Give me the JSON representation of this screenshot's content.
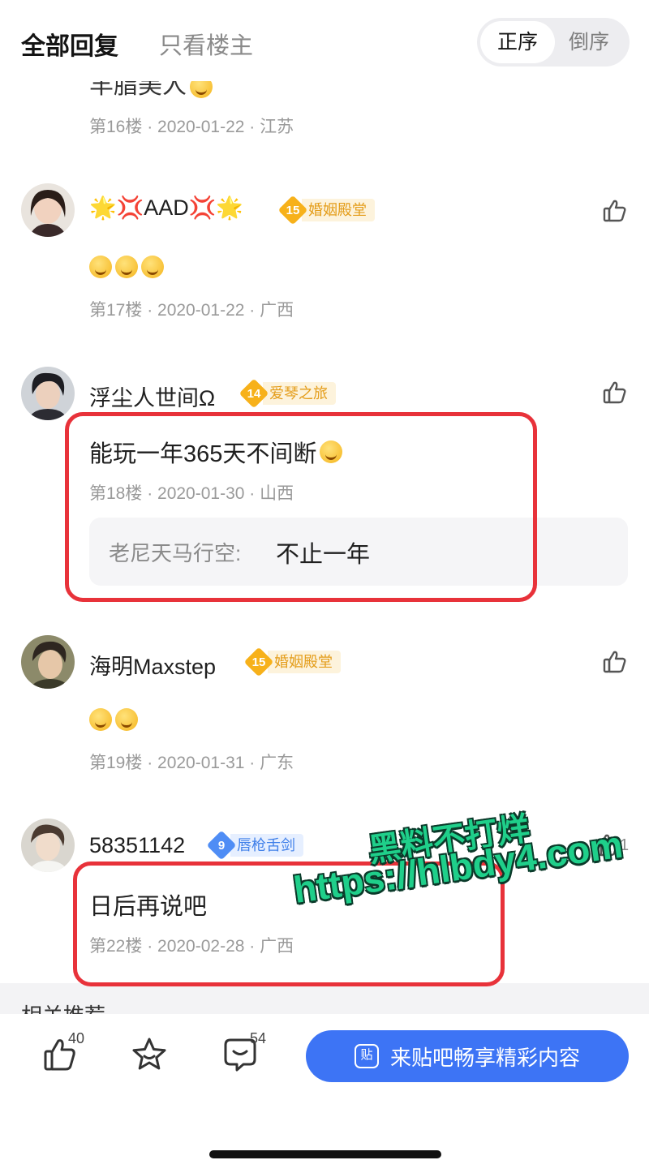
{
  "header": {
    "tab_all": "全部回复",
    "tab_op_only": "只看楼主",
    "order_asc": "正序",
    "order_desc": "倒序"
  },
  "cut_off_post": {
    "text_fragment": "羊脂美人",
    "meta": "第16楼 · 2020-01-22 · 江苏"
  },
  "posts": [
    {
      "username": "🌟💢AAD💢🌟",
      "level": "15",
      "level_title": "婚姻殿堂",
      "content": "",
      "emoji_count": 3,
      "meta": "第17楼 · 2020-01-22 · 广西"
    },
    {
      "username": "浮尘人世间Ω",
      "level": "14",
      "level_title": "爱琴之旅",
      "content": "能玩一年365天不间断",
      "meta": "第18楼 · 2020-01-30 · 山西",
      "reply": {
        "name": "老尼天马行空:",
        "text": "不止一年"
      }
    },
    {
      "username": "海明Maxstep",
      "level": "15",
      "level_title": "婚姻殿堂",
      "content": "",
      "emoji_count": 2,
      "meta": "第19楼 · 2020-01-31 · 广东"
    },
    {
      "username": "58351142",
      "level": "9",
      "level_title": "唇枪舌剑",
      "content": "日后再说吧",
      "meta": "第22楼 · 2020-02-28 · 广西",
      "like_count": "1"
    }
  ],
  "watermark": {
    "line1": "黑料不打烊",
    "line2": "https://hlbdy4.com"
  },
  "section_below": "相关推荐",
  "bottom_bar": {
    "like_count": "40",
    "comment_count": "54",
    "cta_label": "来贴吧畅享精彩内容",
    "cta_icon_text": "贴"
  },
  "colors": {
    "accent": "#3d74f5",
    "level_gold": "#f7b11a",
    "level_blue": "#4f8df5",
    "highlight_red": "#e8323a",
    "watermark_green": "#1fcf8a"
  }
}
